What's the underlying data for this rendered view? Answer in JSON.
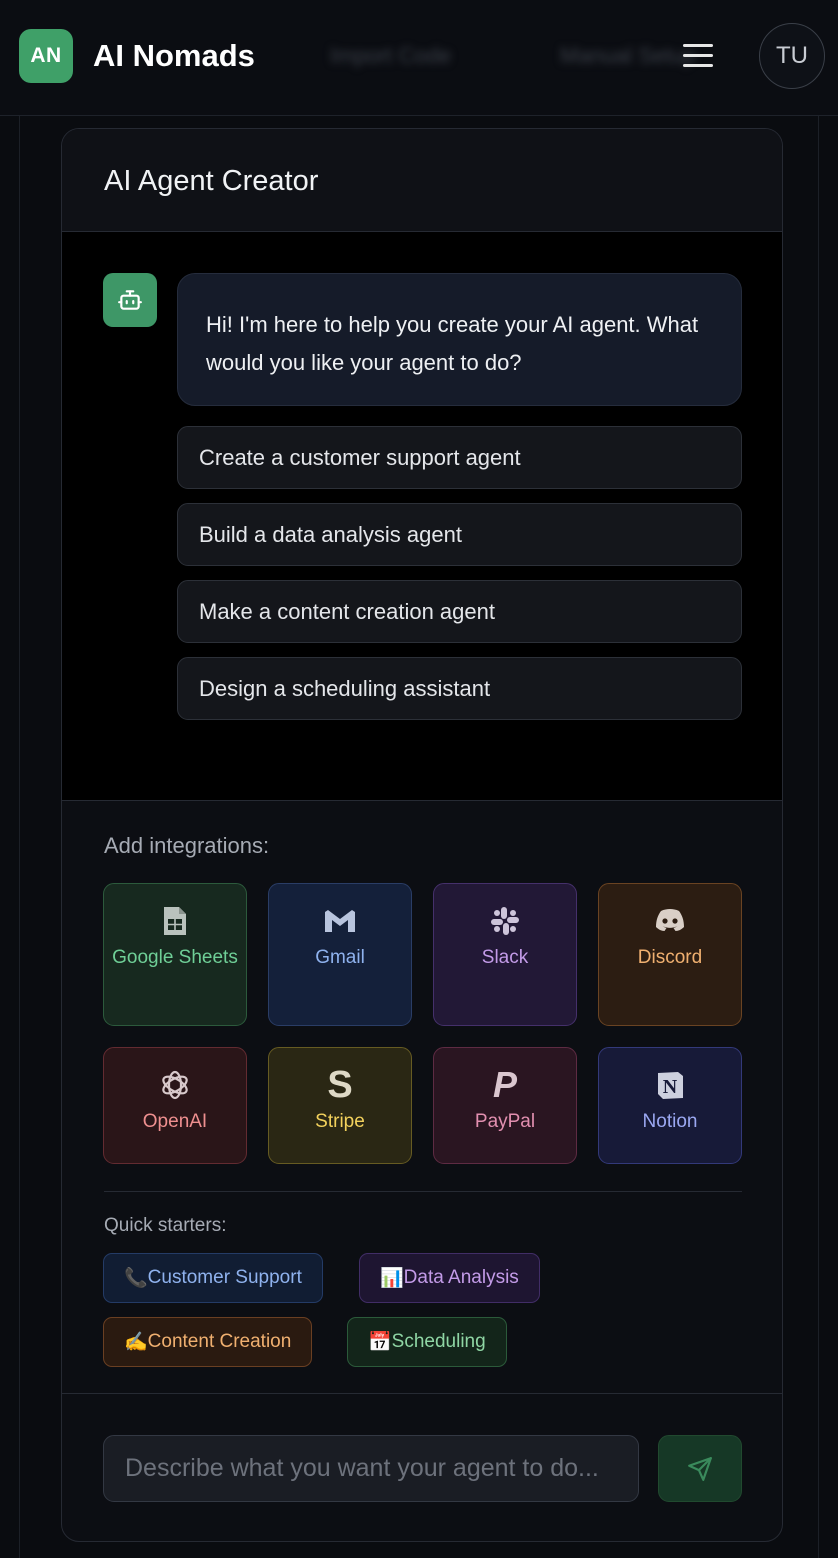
{
  "header": {
    "logo_badge": "AN",
    "brand": "AI Nomads",
    "ghost_items": [
      "Import Code",
      "Manual Setup"
    ],
    "avatar_initials": "TU"
  },
  "card": {
    "title": "AI Agent Creator"
  },
  "chat": {
    "bot_message": "Hi! I'm here to help you create your AI agent. What would you like your agent to do?",
    "suggestions": [
      "Create a customer support agent",
      "Build a data analysis agent",
      "Make a content creation agent",
      "Design a scheduling assistant"
    ]
  },
  "integrations": {
    "label": "Add integrations:",
    "items": [
      {
        "label": "Google Sheets",
        "icon": "sheets-icon",
        "color": "#6fcf97",
        "bg": "#17291f",
        "border": "#2c5a3c"
      },
      {
        "label": "Gmail",
        "icon": "gmail-icon",
        "color": "#8fb2ee",
        "bg": "#14203a",
        "border": "#2a3d66"
      },
      {
        "label": "Slack",
        "icon": "slack-icon",
        "color": "#c39be8",
        "bg": "#221836",
        "border": "#45306b"
      },
      {
        "label": "Discord",
        "icon": "discord-icon",
        "color": "#f0b070",
        "bg": "#2c1d12",
        "border": "#6a4322"
      },
      {
        "label": "OpenAI",
        "icon": "openai-icon",
        "color": "#ee8f8f",
        "bg": "#2a1518",
        "border": "#632b31"
      },
      {
        "label": "Stripe",
        "icon": "stripe-icon",
        "color": "#f2d15c",
        "bg": "#2a2714",
        "border": "#665b22"
      },
      {
        "label": "PayPal",
        "icon": "paypal-icon",
        "color": "#e28fb0",
        "bg": "#2a1521",
        "border": "#5e2b43"
      },
      {
        "label": "Notion",
        "icon": "notion-icon",
        "color": "#9ba8f2",
        "bg": "#171a38",
        "border": "#33397a"
      }
    ]
  },
  "quick_starters": {
    "label": "Quick starters:",
    "items": [
      {
        "emoji": "📞",
        "label": "Customer Support",
        "color": "#8fb2ee",
        "bg": "#111d33",
        "border": "#243b66"
      },
      {
        "emoji": "📊",
        "label": "Data Analysis",
        "color": "#c39be8",
        "bg": "#1e1531",
        "border": "#412d66"
      },
      {
        "emoji": "✍️",
        "label": "Content Creation",
        "color": "#f0b070",
        "bg": "#2a1a10",
        "border": "#6a3f22"
      },
      {
        "emoji": "📅",
        "label": "Scheduling",
        "color": "#8fd6a4",
        "bg": "#13251a",
        "border": "#2b5a3a"
      }
    ]
  },
  "composer": {
    "placeholder": "Describe what you want your agent to do..."
  }
}
